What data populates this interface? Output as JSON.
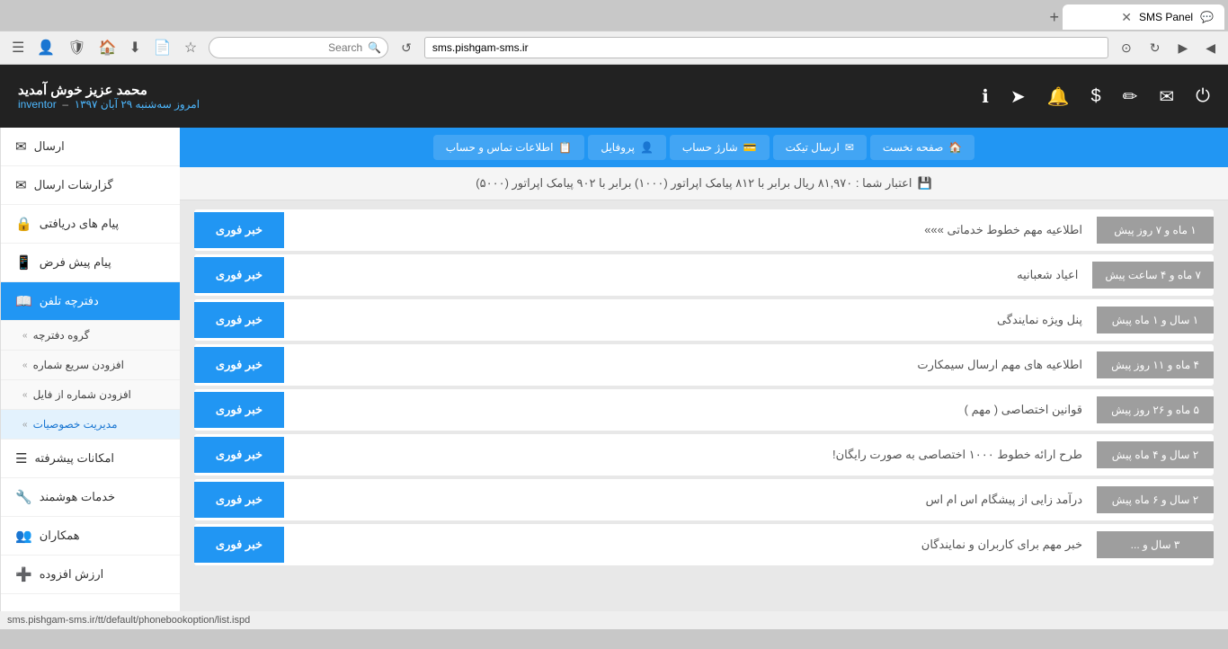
{
  "browser": {
    "tab_title": "SMS Panel",
    "address": "sms.pishgam-sms.ir",
    "search_placeholder": "Search",
    "status_bar": "sms.pishgam-sms.ir/tt/default/phonebookoption/list.ispd"
  },
  "header": {
    "user_name": "محمد عزیز خوش آمدید",
    "user_sub_label": "inventor",
    "user_date": "امروز سه‌شنبه ۲۹ آبان ۱۳۹۷"
  },
  "nav": {
    "items": [
      {
        "label": "صفحه نخست",
        "icon": "🏠"
      },
      {
        "label": "ارسال تیکت",
        "icon": "✉"
      },
      {
        "label": "شارژ حساب",
        "icon": "💳"
      },
      {
        "label": "پروفایل",
        "icon": "👤"
      },
      {
        "label": "اطلاعات تماس و حساب",
        "icon": "📋"
      }
    ]
  },
  "info_bar": {
    "text": "اعتبار شما : ۸۱,۹۷۰ ریال برابر با ۸۱۲ پیامک اپراتور (۱۰۰۰) برابر با ۹۰۲ پیامک اپراتور (۵۰۰۰)"
  },
  "sidebar": {
    "items": [
      {
        "id": "ersal",
        "label": "ارسال",
        "icon": "✉"
      },
      {
        "id": "gozareshat",
        "label": "گزارشات ارسال",
        "icon": "✉"
      },
      {
        "id": "payam-dariyafti",
        "label": "پیام های دریافتی",
        "icon": "🔒"
      },
      {
        "id": "payam-pish-farz",
        "label": "پیام پیش فرض",
        "icon": "📱"
      },
      {
        "id": "daftarche",
        "label": "دفترچه تلفن",
        "icon": "📖",
        "active": true
      }
    ],
    "subitems": [
      {
        "id": "gorooh",
        "label": "گروه دفترچه"
      },
      {
        "id": "afzoodan-sari",
        "label": "افزودن سریع شماره"
      },
      {
        "id": "afzoodan-file",
        "label": "افزودن شماره از فایل"
      },
      {
        "id": "modiriyat",
        "label": "مدیریت خصوصیات",
        "active_sub": true
      }
    ],
    "bottom_items": [
      {
        "id": "emkanat",
        "label": "امکانات پیشرفته",
        "icon": "☰"
      },
      {
        "id": "khadamat",
        "label": "خدمات هوشمند",
        "icon": "🔧"
      },
      {
        "id": "hamkaran",
        "label": "همکاران",
        "icon": "👥"
      },
      {
        "id": "arzesh",
        "label": "ارزش افزوده",
        "icon": "➕"
      }
    ]
  },
  "inbox": {
    "items": [
      {
        "tag": "خبر فوری",
        "content": "اطلاعیه مهم خطوط خدماتی »»»",
        "time": "۱ ماه و ۷ روز پیش"
      },
      {
        "tag": "خبر فوری",
        "content": "اعیاد شعبانیه",
        "time": "۷ ماه و ۴ ساعت پیش"
      },
      {
        "tag": "خبر فوری",
        "content": "پنل ویژه نمایندگی",
        "time": "۱ سال و ۱ ماه پیش"
      },
      {
        "tag": "خبر فوری",
        "content": "اطلاعیه های مهم ارسال سیمکارت",
        "time": "۴ ماه و ۱۱ روز پیش"
      },
      {
        "tag": "خبر فوری",
        "content": "قوانین اختصاصی ( مهم )",
        "time": "۵ ماه و ۲۶ روز پیش"
      },
      {
        "tag": "خبر فوری",
        "content": "طرح ارائه خطوط ۱۰۰۰ اختصاصی به صورت رایگان!",
        "time": "۲ سال و ۴ ماه پیش"
      },
      {
        "tag": "خبر فوری",
        "content": "درآمد زایی از پیشگام اس ام اس",
        "time": "۲ سال و ۶ ماه پیش"
      },
      {
        "tag": "خبر فوری",
        "content": "خبر مهم برای کاربران و نمایندگان",
        "time": "۳ سال و ..."
      }
    ]
  }
}
